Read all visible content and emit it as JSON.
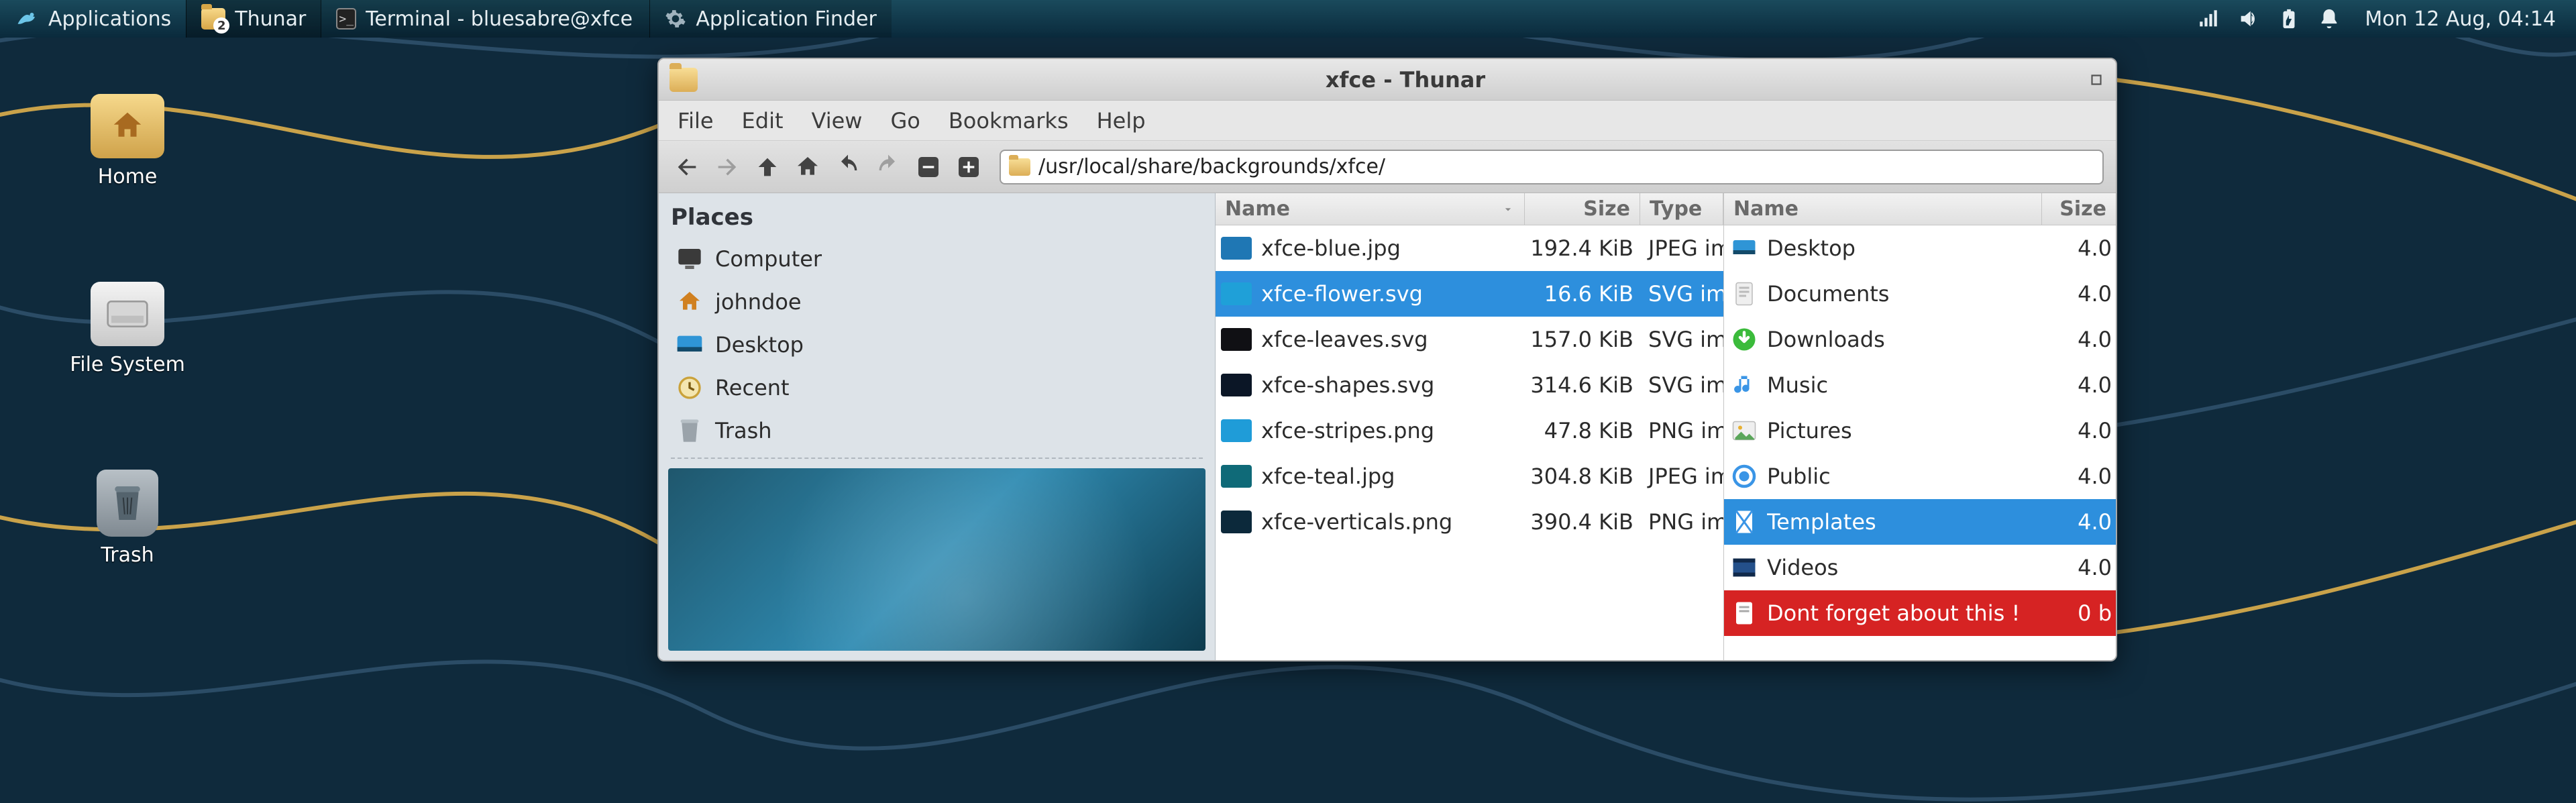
{
  "panel": {
    "apps_label": "Applications",
    "task_thunar": "Thunar",
    "task_thunar_badge": "2",
    "task_terminal": "Terminal - bluesabre@xfce....",
    "task_appfinder": "Application Finder",
    "clock": "Mon 12 Aug, 04:14"
  },
  "desktop": {
    "home": "Home",
    "filesystem": "File System",
    "trash": "Trash"
  },
  "window": {
    "title": "xfce - Thunar",
    "menu": {
      "file": "File",
      "edit": "Edit",
      "view": "View",
      "go": "Go",
      "bookmarks": "Bookmarks",
      "help": "Help"
    },
    "path": "/usr/local/share/backgrounds/xfce/",
    "places_heading": "Places",
    "places": {
      "computer": "Computer",
      "home": "johndoe",
      "desktop": "Desktop",
      "recent": "Recent",
      "trash": "Trash"
    },
    "columns": {
      "name": "Name",
      "size": "Size",
      "type": "Type"
    },
    "files": [
      {
        "name": "xfce-blue.jpg",
        "size": "192.4  KiB",
        "type": "JPEG im",
        "thumb": "#1f77b4",
        "sel": false
      },
      {
        "name": "xfce-flower.svg",
        "size": "16.6  KiB",
        "type": "SVG im",
        "thumb": "#1fa0d8",
        "sel": true
      },
      {
        "name": "xfce-leaves.svg",
        "size": "157.0  KiB",
        "type": "SVG im",
        "thumb": "#101014",
        "sel": false
      },
      {
        "name": "xfce-shapes.svg",
        "size": "314.6  KiB",
        "type": "SVG im",
        "thumb": "#0b1626",
        "sel": false
      },
      {
        "name": "xfce-stripes.png",
        "size": "47.8  KiB",
        "type": "PNG im",
        "thumb": "#1f9cd8",
        "sel": false
      },
      {
        "name": "xfce-teal.jpg",
        "size": "304.8  KiB",
        "type": "JPEG im",
        "thumb": "#0f6a78",
        "sel": false
      },
      {
        "name": "xfce-verticals.png",
        "size": "390.4  KiB",
        "type": "PNG im",
        "thumb": "#0c293b",
        "sel": false
      }
    ]
  },
  "rightpane": {
    "columns": {
      "name": "Name",
      "size": "Size"
    },
    "rows": [
      {
        "icon": "desktop",
        "label": "Desktop",
        "size": "4.0"
      },
      {
        "icon": "docs",
        "label": "Documents",
        "size": "4.0"
      },
      {
        "icon": "dl",
        "label": "Downloads",
        "size": "4.0"
      },
      {
        "icon": "music",
        "label": "Music",
        "size": "4.0"
      },
      {
        "icon": "pics",
        "label": "Pictures",
        "size": "4.0"
      },
      {
        "icon": "pub",
        "label": "Public",
        "size": "4.0"
      },
      {
        "icon": "tmpl",
        "label": "Templates",
        "size": "4.0",
        "sel": true
      },
      {
        "icon": "vid",
        "label": "Videos",
        "size": "4.0"
      },
      {
        "icon": "note",
        "label": "Dont forget about this !",
        "size": "0 b",
        "red": true
      }
    ]
  }
}
